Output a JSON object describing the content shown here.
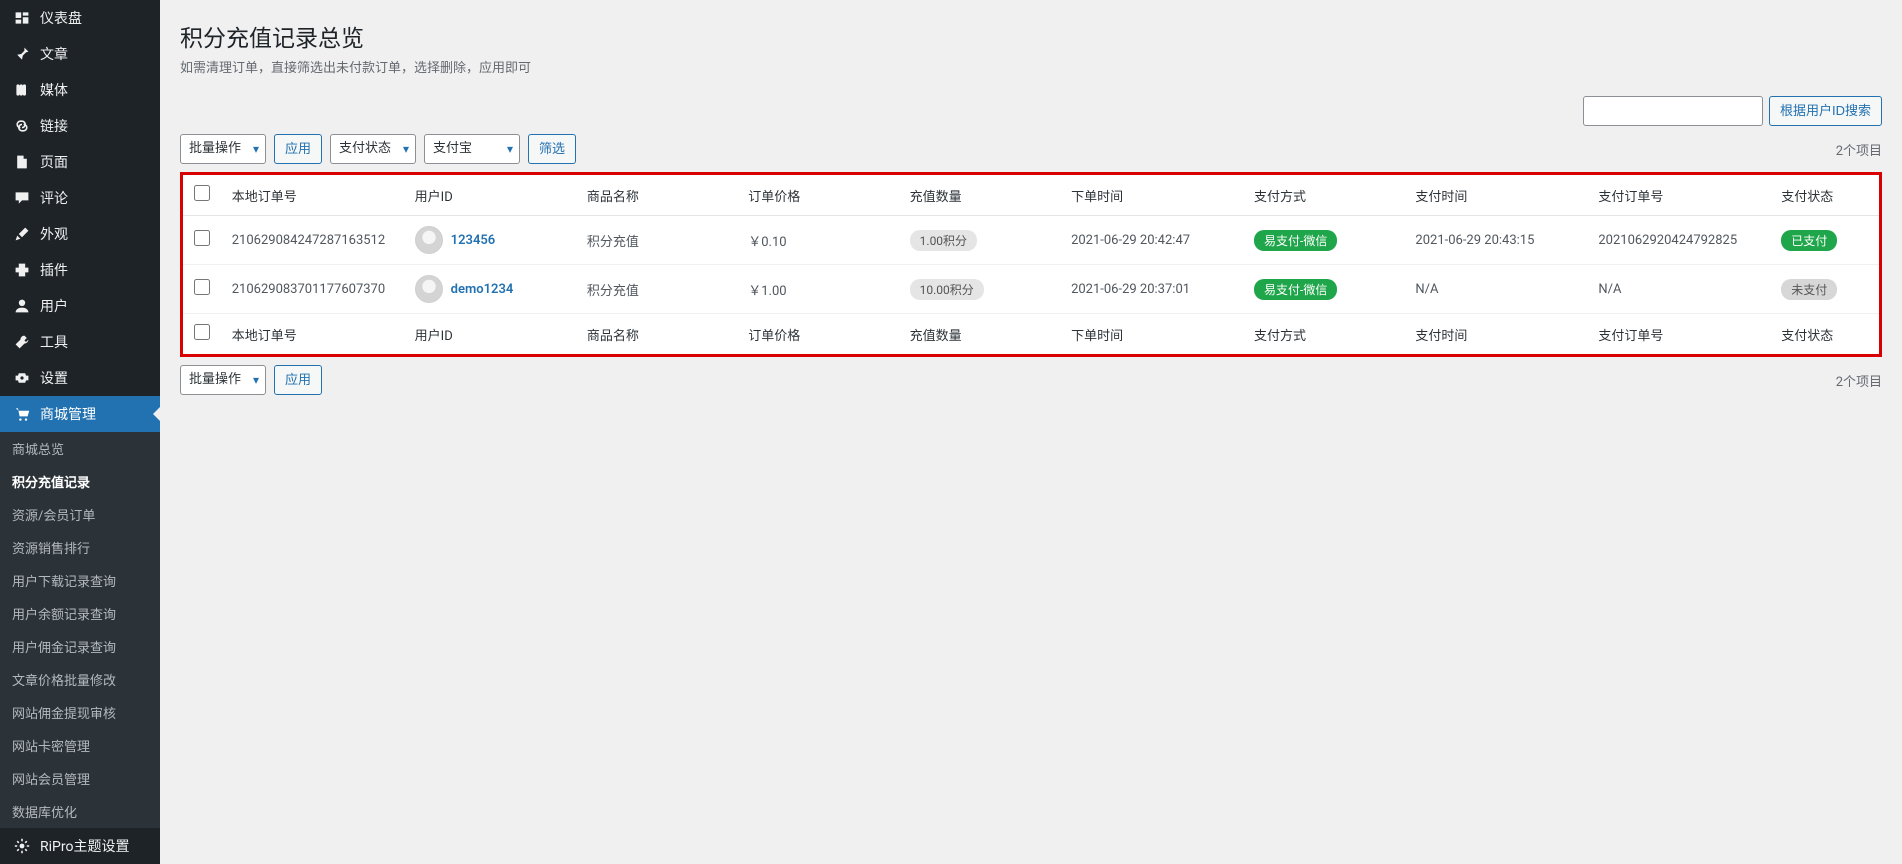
{
  "sidebar": {
    "items": [
      {
        "icon": "dashboard",
        "label": "仪表盘"
      },
      {
        "icon": "pin",
        "label": "文章"
      },
      {
        "icon": "media",
        "label": "媒体"
      },
      {
        "icon": "link",
        "label": "链接"
      },
      {
        "icon": "page",
        "label": "页面"
      },
      {
        "icon": "comment",
        "label": "评论"
      },
      {
        "icon": "brush",
        "label": "外观"
      },
      {
        "icon": "plugin",
        "label": "插件"
      },
      {
        "icon": "user",
        "label": "用户"
      },
      {
        "icon": "tool",
        "label": "工具"
      },
      {
        "icon": "setting",
        "label": "设置"
      }
    ],
    "shop": {
      "label": "商城管理",
      "submenu": [
        "商城总览",
        "积分充值记录",
        "资源/会员订单",
        "资源销售排行",
        "用户下载记录查询",
        "用户余额记录查询",
        "用户佣金记录查询",
        "文章价格批量修改",
        "网站佣金提现审核",
        "网站卡密管理",
        "网站会员管理",
        "数据库优化"
      ]
    },
    "theme": {
      "label": "RiPro主题设置"
    }
  },
  "header": {
    "title": "积分充值记录总览",
    "subtitle": "如需清理订单，直接筛选出未付款订单，选择删除，应用即可"
  },
  "filters": {
    "bulk_action": "批量操作",
    "apply": "应用",
    "pay_status": "支付状态",
    "pay_method": "支付宝",
    "filter": "筛选"
  },
  "search": {
    "placeholder": "",
    "button": "根据用户ID搜索"
  },
  "count_text": "2个项目",
  "columns": {
    "order_no": "本地订单号",
    "user_id": "用户ID",
    "product": "商品名称",
    "price": "订单价格",
    "qty": "充值数量",
    "order_time": "下单时间",
    "method": "支付方式",
    "pay_time": "支付时间",
    "pay_no": "支付订单号",
    "status": "支付状态"
  },
  "rows": [
    {
      "order_no": "210629084247287163512",
      "user": "123456",
      "product": "积分充值",
      "price": "￥0.10",
      "qty": "1.00积分",
      "order_time": "2021-06-29 20:42:47",
      "method": "易支付-微信",
      "pay_time": "2021-06-29 20:43:15",
      "pay_no": "2021062920424792825",
      "status": "已支付",
      "status_type": "paid"
    },
    {
      "order_no": "210629083701177607370",
      "user": "demo1234",
      "product": "积分充值",
      "price": "￥1.00",
      "qty": "10.00积分",
      "order_time": "2021-06-29 20:37:01",
      "method": "易支付-微信",
      "pay_time": "N/A",
      "pay_no": "N/A",
      "status": "未支付",
      "status_type": "unpaid"
    }
  ]
}
